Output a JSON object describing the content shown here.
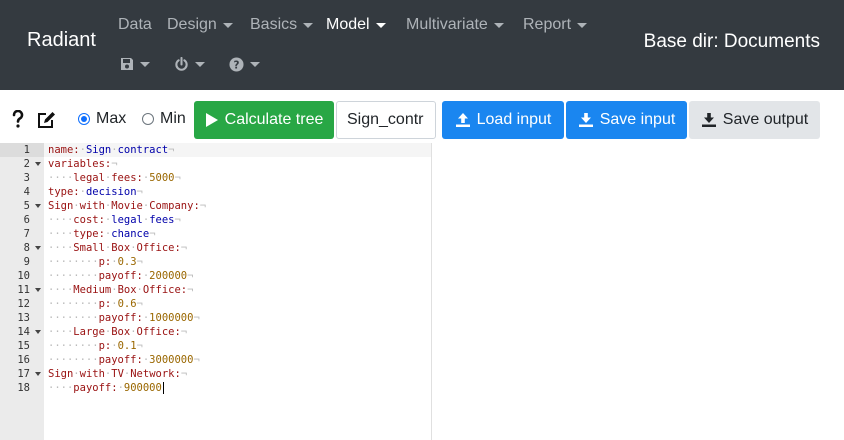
{
  "navbar": {
    "brand": "Radiant",
    "menus": [
      {
        "label": "Data",
        "has_caret": false,
        "active": false
      },
      {
        "label": "Design",
        "has_caret": true,
        "active": false
      },
      {
        "label": "Basics",
        "has_caret": true,
        "active": false
      },
      {
        "label": "Model",
        "has_caret": true,
        "active": true
      },
      {
        "label": "Multivariate",
        "has_caret": true,
        "active": false
      },
      {
        "label": "Report",
        "has_caret": true,
        "active": false
      }
    ],
    "icon_menus": [
      "save-icon",
      "power-icon",
      "help-circle-icon"
    ],
    "base_dir": "Base dir: Documents"
  },
  "toolbar": {
    "help_icon": "question-icon",
    "edit_icon": "edit-icon",
    "radio_max": "Max",
    "radio_min": "Min",
    "selected": "Max",
    "calculate_label": "Calculate tree",
    "name_input_value": "Sign_contr",
    "load_input_label": "Load input",
    "save_input_label": "Save input",
    "save_output_label": "Save output",
    "colors": {
      "success": "#28a745",
      "primary": "#1a86f0",
      "light": "#e2e5e8",
      "navbar": "#343a40"
    }
  },
  "editor": {
    "lines": [
      {
        "num": "1",
        "fold": false,
        "indent": 0,
        "key": "name",
        "value": "Sign contract"
      },
      {
        "num": "2",
        "fold": true,
        "indent": 0,
        "key": "variables",
        "value": ""
      },
      {
        "num": "3",
        "fold": false,
        "indent": 1,
        "key": "legal fees",
        "value": "5000"
      },
      {
        "num": "4",
        "fold": false,
        "indent": 0,
        "key": "type",
        "value": "decision"
      },
      {
        "num": "5",
        "fold": true,
        "indent": 0,
        "key": "Sign with Movie Company",
        "value": ""
      },
      {
        "num": "6",
        "fold": false,
        "indent": 1,
        "key": "cost",
        "value": "legal fees"
      },
      {
        "num": "7",
        "fold": false,
        "indent": 1,
        "key": "type",
        "value": "chance"
      },
      {
        "num": "8",
        "fold": true,
        "indent": 1,
        "key": "Small Box Office",
        "value": ""
      },
      {
        "num": "9",
        "fold": false,
        "indent": 2,
        "key": "p",
        "value": "0.3"
      },
      {
        "num": "10",
        "fold": false,
        "indent": 2,
        "key": "payoff",
        "value": "200000"
      },
      {
        "num": "11",
        "fold": true,
        "indent": 1,
        "key": "Medium Box Office",
        "value": ""
      },
      {
        "num": "12",
        "fold": false,
        "indent": 2,
        "key": "p",
        "value": "0.6"
      },
      {
        "num": "13",
        "fold": false,
        "indent": 2,
        "key": "payoff",
        "value": "1000000"
      },
      {
        "num": "14",
        "fold": true,
        "indent": 1,
        "key": "Large Box Office",
        "value": ""
      },
      {
        "num": "15",
        "fold": false,
        "indent": 2,
        "key": "p",
        "value": "0.1"
      },
      {
        "num": "16",
        "fold": false,
        "indent": 2,
        "key": "payoff",
        "value": "3000000"
      },
      {
        "num": "17",
        "fold": true,
        "indent": 0,
        "key": "Sign with TV Network",
        "value": ""
      },
      {
        "num": "18",
        "fold": false,
        "indent": 1,
        "key": "payoff",
        "value": "900000"
      }
    ]
  }
}
